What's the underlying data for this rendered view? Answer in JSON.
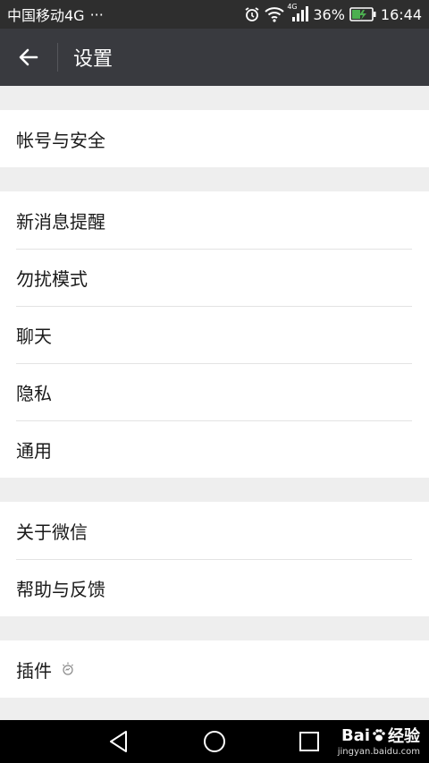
{
  "status_bar": {
    "carrier": "中国移动4G",
    "more": "···",
    "network_small": "4G",
    "battery": "36%",
    "time": "16:44",
    "icons": [
      "alarm-icon",
      "wifi-icon",
      "signal-icon",
      "battery-charging-icon"
    ]
  },
  "app_bar": {
    "title": "设置",
    "back_icon": "arrow-left-icon"
  },
  "groups": [
    {
      "items": [
        {
          "label": "帐号与安全"
        }
      ]
    },
    {
      "items": [
        {
          "label": "新消息提醒"
        },
        {
          "label": "勿扰模式"
        },
        {
          "label": "聊天"
        },
        {
          "label": "隐私"
        },
        {
          "label": "通用"
        }
      ]
    },
    {
      "items": [
        {
          "label": "关于微信"
        },
        {
          "label": "帮助与反馈"
        }
      ]
    },
    {
      "items": [
        {
          "label": "插件",
          "icon": "lightbulb-icon"
        }
      ]
    }
  ],
  "nav_bar": {
    "icons": [
      "nav-back-icon",
      "nav-home-icon",
      "nav-recents-icon"
    ]
  },
  "watermark": {
    "logo_left": "Bai",
    "logo_right": "经验",
    "url": "jingyan.baidu.com"
  },
  "colors": {
    "status_bar": "#2e2e2e",
    "app_bar": "#393a3f",
    "background": "#eeeeee",
    "row": "#ffffff",
    "nav_bar": "#000000"
  }
}
